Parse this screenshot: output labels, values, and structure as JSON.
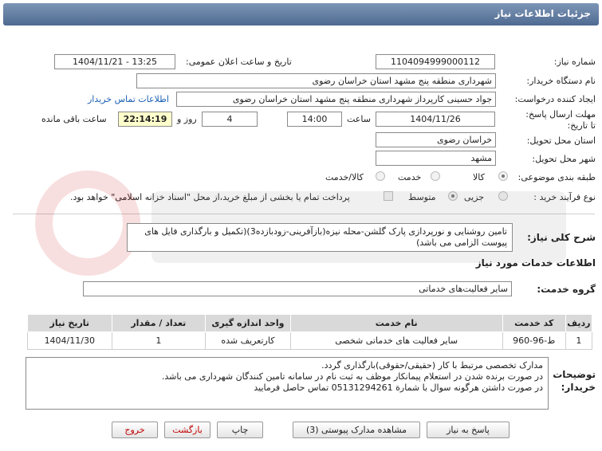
{
  "header": {
    "title": "جزئیات اطلاعات نیاز"
  },
  "fields": {
    "need_number_label": "شماره نیاز:",
    "need_number": "1104094999000112",
    "announce_label": "تاریخ و ساعت اعلان عمومی:",
    "announce_value": "1404/11/21 - 13:25",
    "buyer_label": "نام دستگاه خریدار:",
    "buyer_value": "شهرداری منطقه پنج مشهد استان خراسان رضوی",
    "creator_label": "ایجاد کننده درخواست:",
    "creator_value": "جواد حسینی کارپرداز شهرداری منطقه پنج مشهد استان خراسان رضوی",
    "contact_link": "اطلاعات تماس خریدار",
    "deadline_label": "مهلت ارسال پاسخ: تا تاریخ:",
    "deadline_date": "1404/11/26",
    "time_label": "ساعت",
    "deadline_time": "14:00",
    "days_value": "4",
    "days_label": "روز و",
    "remaining_time": "22:14:19",
    "remaining_label": "ساعت باقی مانده",
    "province_label": "استان محل تحویل:",
    "province_value": "خراسان رضوی",
    "city_label": "شهر محل تحویل:",
    "city_value": "مشهد",
    "category_label": "طبقه بندی موضوعی:",
    "category_options": [
      "کالا",
      "خدمت",
      "کالا/خدمت"
    ],
    "process_label": "نوع فرآیند خرید :",
    "process_options": [
      "جزیی",
      "متوسط"
    ],
    "payment_note": "پرداخت تمام یا بخشی از مبلغ خرید،از محل \"اسناد خزانه اسلامی\" خواهد بود."
  },
  "summary": {
    "label": "شرح کلی نیاز:",
    "value": "تامین روشنایی و نورپردازی پارک گلشن-محله نیزه(بازآفرینی-زودبازده3)(تکمیل و بارگذاری فایل های پیوست الزامی می باشد)"
  },
  "services": {
    "title": "اطلاعات خدمات مورد نیاز",
    "group_label": "گروه خدمت:",
    "group_value": "سایر فعالیت‌های خدماتی"
  },
  "table": {
    "headers": [
      "ردیف",
      "کد خدمت",
      "نام خدمت",
      "واحد اندازه گیری",
      "تعداد / مقدار",
      "تاریخ نیاز"
    ],
    "rows": [
      [
        "1",
        "ط-96-960",
        "سایر فعالیت های خدماتی شخصی",
        "کارتعریف شده",
        "1",
        "1404/11/30"
      ]
    ]
  },
  "notes": {
    "label": "توضیحات خریدار:",
    "lines": [
      "مدارک تخصصی مرتبط با کار (حقیقی/حقوقی)بارگذاری گردد.",
      "در صورت برنده شدن در استعلام پیمانکار موظف به ثبت نام در سامانه تامین کنندگان شهرداری می باشد.",
      "در صورت داشتن هرگونه سوال  با شمارة 05131294261 تماس حاصل فرمایید"
    ]
  },
  "buttons": {
    "reply": "پاسخ به نیاز",
    "attachments": "مشاهده مدارک پیوستی (3)",
    "print": "چاپ",
    "back": "بازگشت",
    "exit": "خروج"
  }
}
